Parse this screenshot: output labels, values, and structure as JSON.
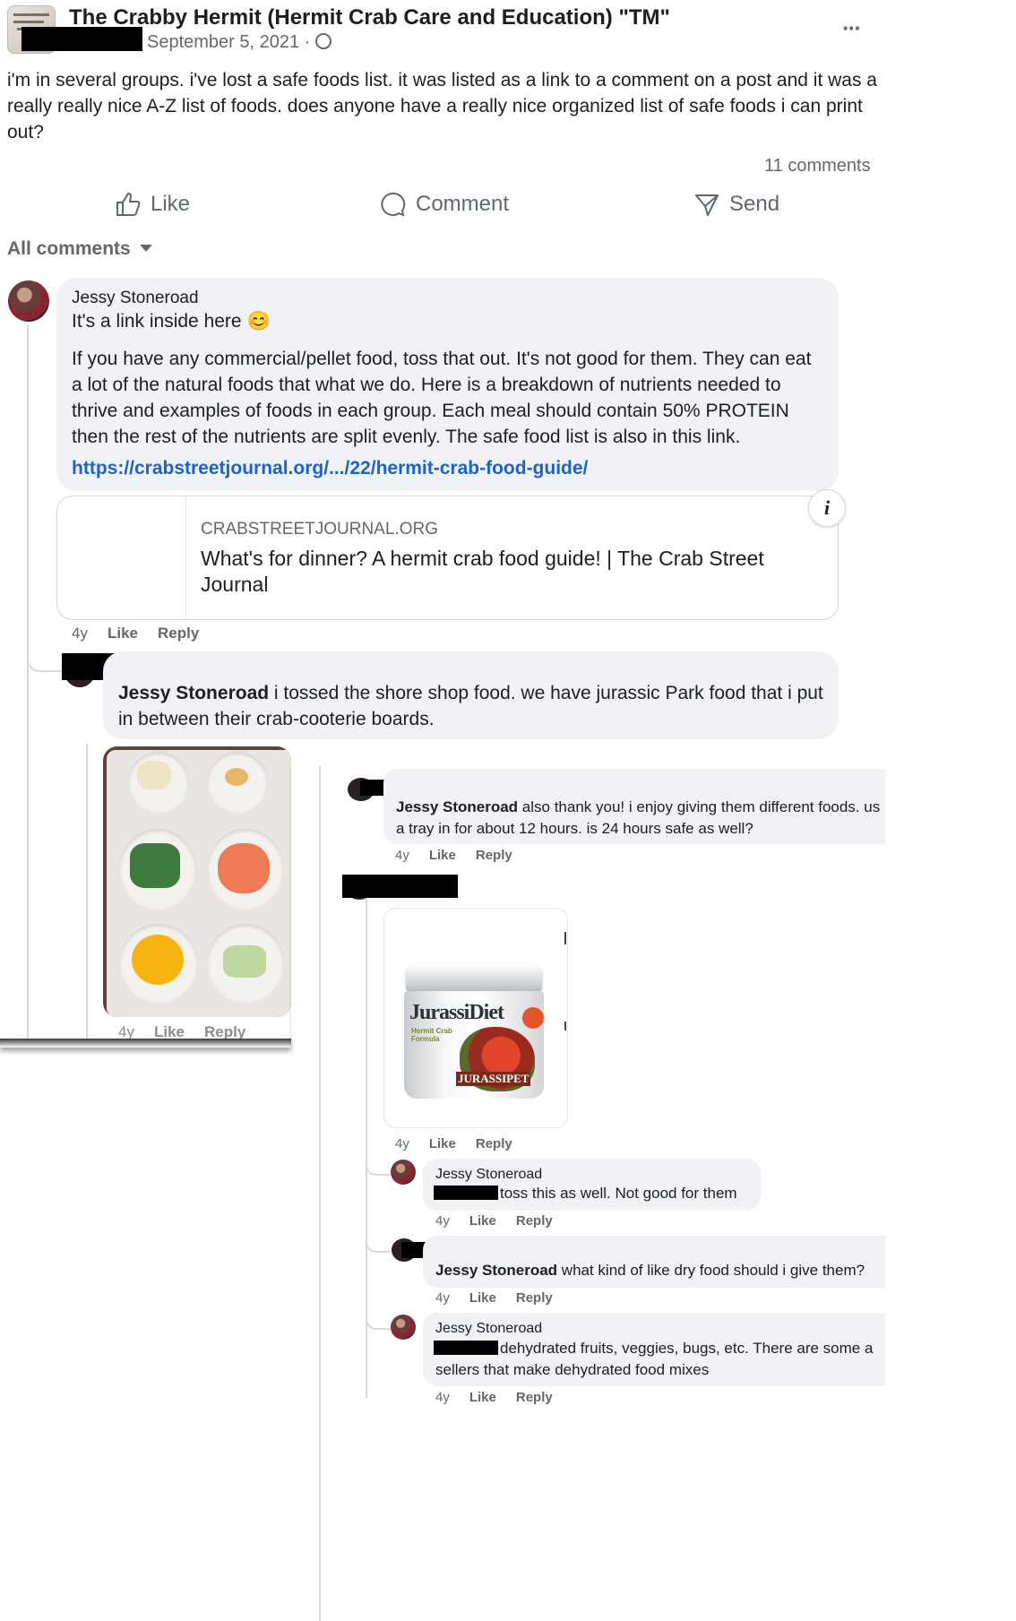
{
  "post": {
    "group_name": "The Crabby Hermit (Hermit Crab Care and Education) \"TM\"",
    "date": "September 5, 2021 · ",
    "menu": "···",
    "text": "i'm in several groups. i've lost a safe foods list. it was listed as a link to a comment on a post and it was a really really nice A-Z list of foods. does anyone have a really nice organized list of safe foods i can print out?",
    "comments_count": "11 comments"
  },
  "actions": {
    "like": "Like",
    "comment": "Comment",
    "send": "Send"
  },
  "comments_filter": "All comments",
  "c1": {
    "author": "Jessy Stoneroad",
    "line1": "It's a link inside here 😊",
    "body": "If you have any commercial/pellet food, toss that out. It's not good for them. They can eat a lot of the natural foods that what we do. Here is a breakdown of nutrients needed to thrive and examples of foods in each group. Each meal should contain 50% PROTEIN then the rest of the nutrients are split evenly. The safe food list is also in this link.",
    "link": "https://crabstreetjournal.org/.../22/hermit-crab-food-guide/",
    "preview_domain": "CRABSTREETJOURNAL.ORG",
    "preview_title": "What's for dinner? A hermit crab food guide! | The Crab Street Journal",
    "info_icon": "i",
    "time": "4y",
    "like": "Like",
    "reply": "Reply"
  },
  "c2": {
    "mention": "Jessy Stoneroad",
    "text": " i tossed the shore shop food. we have jurassic Park food that i put in between their crab-cooterie boards.",
    "time": "4y",
    "like": "Like",
    "reply": "Reply"
  },
  "c3": {
    "mention": "Jessy Stoneroad",
    "text": " also thank you! i enjoy giving them different foods. us",
    "text2": "a tray in for about 12 hours. is 24 hours safe as well?",
    "time": "4y",
    "like": "Like",
    "reply": "Reply"
  },
  "c4": {
    "product_brand": "JurassiDiet",
    "product_sub": "Hermit Crab Formula",
    "product_logo": "JURASSIPET",
    "time": "4y",
    "like": "Like",
    "reply": "Reply"
  },
  "c5": {
    "author": "Jessy Stoneroad",
    "text": "toss this as well. Not good for them",
    "time": "4y",
    "like": "Like",
    "reply": "Reply"
  },
  "c6": {
    "mention": "Jessy Stoneroad",
    "text": " what kind of like dry food should i give them?",
    "time": "4y",
    "like": "Like",
    "reply": "Reply"
  },
  "c7": {
    "author": "Jessy Stoneroad",
    "text": "dehydrated fruits, veggies, bugs, etc. There are some a",
    "text2": "sellers that make dehydrated food mixes",
    "time": "4y",
    "like": "Like",
    "reply": "Reply"
  },
  "colors": {
    "link": "#1a64c9",
    "bubble": "#f0f2f5",
    "muted": "#65676b"
  }
}
